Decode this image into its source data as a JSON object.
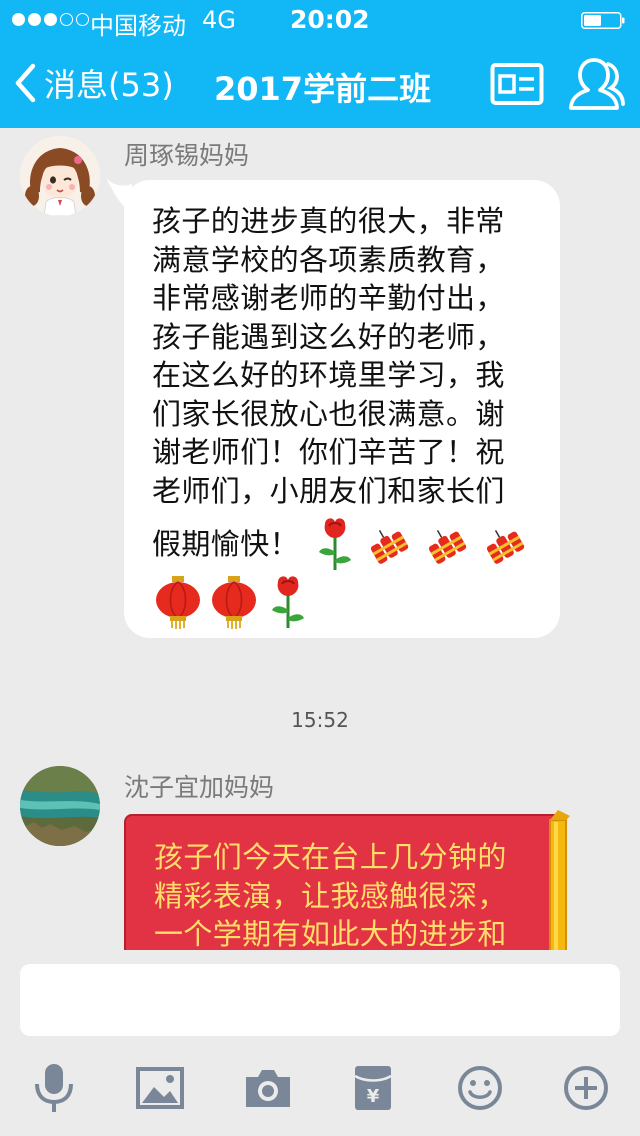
{
  "status_bar": {
    "carrier": "中国移动",
    "network": "4G",
    "time": "20:02",
    "signal_strength": 3,
    "signal_max": 5
  },
  "nav": {
    "back_label": "消息(53)",
    "title": "2017学前二班",
    "icons": [
      "chevron-left-icon",
      "contact-card-icon",
      "group-members-icon"
    ]
  },
  "messages": [
    {
      "sender": "周琢锡妈妈",
      "lines": [
        "孩子的进步真的很大，非常",
        "满意学校的各项素质教育，",
        "非常感谢老师的辛勤付出，",
        "孩子能遇到这么好的老师，",
        "在这么好的环境里学习，我",
        "们家长很放心也很满意。谢",
        "谢老师们！你们辛苦了！祝",
        "老师们，小朋友们和家长们"
      ],
      "last_line": "假期愉快！",
      "emoji_row1": [
        "rose-icon",
        "firecracker-icon",
        "firecracker-icon",
        "firecracker-icon"
      ],
      "emoji_row2": [
        "lantern-icon",
        "lantern-icon",
        "rose-icon"
      ]
    },
    {
      "time": "15:52"
    },
    {
      "sender": "沈子宜加妈妈",
      "lines": [
        "孩子们今天在台上几分钟的",
        "精彩表演，让我感触很深，",
        "一个学期有如此大的进步和"
      ]
    }
  ],
  "input": {
    "value": "",
    "placeholder": ""
  },
  "toolbar": [
    "microphone-icon",
    "image-icon",
    "camera-icon",
    "red-packet-icon",
    "emoji-icon",
    "plus-icon"
  ],
  "colors": {
    "header": "#12b7f5",
    "background": "#ebebeb",
    "red_bubble": "#e23344",
    "red_bubble_text": "#ffde6a",
    "toolbar_icon": "#7a8798"
  }
}
